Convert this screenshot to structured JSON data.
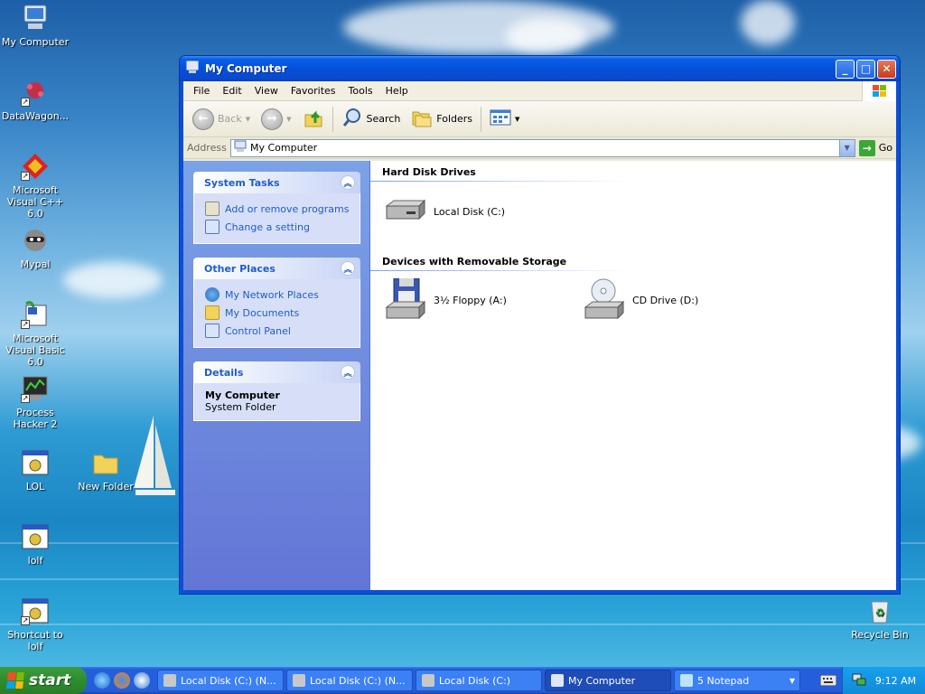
{
  "desktop": {
    "icons": [
      {
        "label": "My Computer",
        "icon": "computer-icon"
      },
      {
        "label": "DataWagon...",
        "icon": "molecule-icon",
        "shortcut": true
      },
      {
        "label": "Microsoft Visual C++ 6.0",
        "icon": "visual-cpp-icon",
        "shortcut": true
      },
      {
        "label": "Mypal",
        "icon": "raccoon-icon",
        "shortcut": true
      },
      {
        "label": "Microsoft Visual Basic 6.0",
        "icon": "visual-basic-icon",
        "shortcut": true
      },
      {
        "label": "Process Hacker 2",
        "icon": "process-hacker-icon",
        "shortcut": true
      },
      {
        "label": "LOL",
        "icon": "batch-file-icon"
      },
      {
        "label": "New Folder",
        "icon": "folder-icon"
      },
      {
        "label": "lolf",
        "icon": "batch-file-icon"
      },
      {
        "label": "Shortcut to lolf",
        "icon": "batch-file-icon",
        "shortcut": true
      },
      {
        "label": "Recycle Bin",
        "icon": "recycle-bin-icon"
      }
    ]
  },
  "window": {
    "title": "My Computer",
    "menu": [
      "File",
      "Edit",
      "View",
      "Favorites",
      "Tools",
      "Help"
    ],
    "toolbar": {
      "back": "Back",
      "search": "Search",
      "folders": "Folders"
    },
    "address": {
      "label": "Address",
      "value": "My Computer",
      "go": "Go"
    },
    "sidepane": {
      "system_tasks": {
        "title": "System Tasks",
        "items": [
          "Add or remove programs",
          "Change a setting"
        ]
      },
      "other_places": {
        "title": "Other Places",
        "items": [
          "My Network Places",
          "My Documents",
          "Control Panel"
        ]
      },
      "details": {
        "title": "Details",
        "name": "My Computer",
        "description": "System Folder"
      }
    },
    "groups": {
      "hard_disks": {
        "title": "Hard Disk Drives",
        "items": [
          "Local Disk (C:)"
        ]
      },
      "removable": {
        "title": "Devices with Removable Storage",
        "items": [
          "3½ Floppy (A:)",
          "CD Drive (D:)"
        ]
      }
    }
  },
  "taskbar": {
    "start": "start",
    "buttons": [
      {
        "label": "Local Disk (C:) (N...",
        "active": false
      },
      {
        "label": "Local Disk (C:) (N...",
        "active": false
      },
      {
        "label": "Local Disk (C:)",
        "active": false
      },
      {
        "label": "My Computer",
        "active": true
      },
      {
        "label": "5 Notepad",
        "active": false,
        "group": true
      }
    ],
    "clock": "9:12 AM"
  },
  "colors": {
    "xp_blue": "#0a4fd6",
    "task_link": "#215dc6",
    "start_green": "#3c9d3c"
  }
}
